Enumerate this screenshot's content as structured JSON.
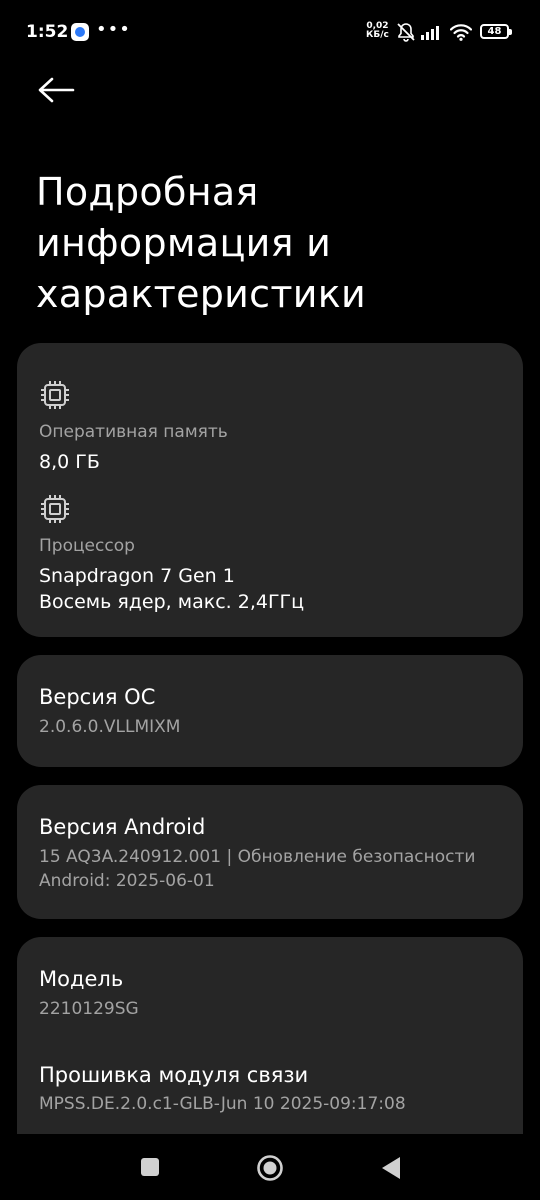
{
  "status_bar": {
    "time": "1:52",
    "overflow": "•••",
    "speed_value": "0,02",
    "speed_unit": "КБ/с",
    "battery": "48"
  },
  "page": {
    "title": "Подробная информация и характеристики"
  },
  "specs": {
    "ram_label": "Оперативная память",
    "ram_value": "8,0 ГБ",
    "cpu_label": "Процессор",
    "cpu_value_line1": "Snapdragon 7 Gen 1",
    "cpu_value_line2": "Восемь ядер, макс. 2,4ГГц"
  },
  "os": {
    "title": "Версия ОС",
    "value": "2.0.6.0.VLLMIXM"
  },
  "android": {
    "title": "Версия Android",
    "value_line1": "15 AQ3A.240912.001 | Обновление безопасности",
    "value_line2": "Android: 2025-06-01"
  },
  "model": {
    "title": "Модель",
    "value": "2210129SG"
  },
  "baseband": {
    "title": "Прошивка модуля связи",
    "value": "MPSS.DE.2.0.c1-GLB-Jun 10 2025-09:17:08"
  },
  "colors": {
    "background": "#000000",
    "card": "#262626",
    "secondary_text": "#a3a3a3"
  }
}
